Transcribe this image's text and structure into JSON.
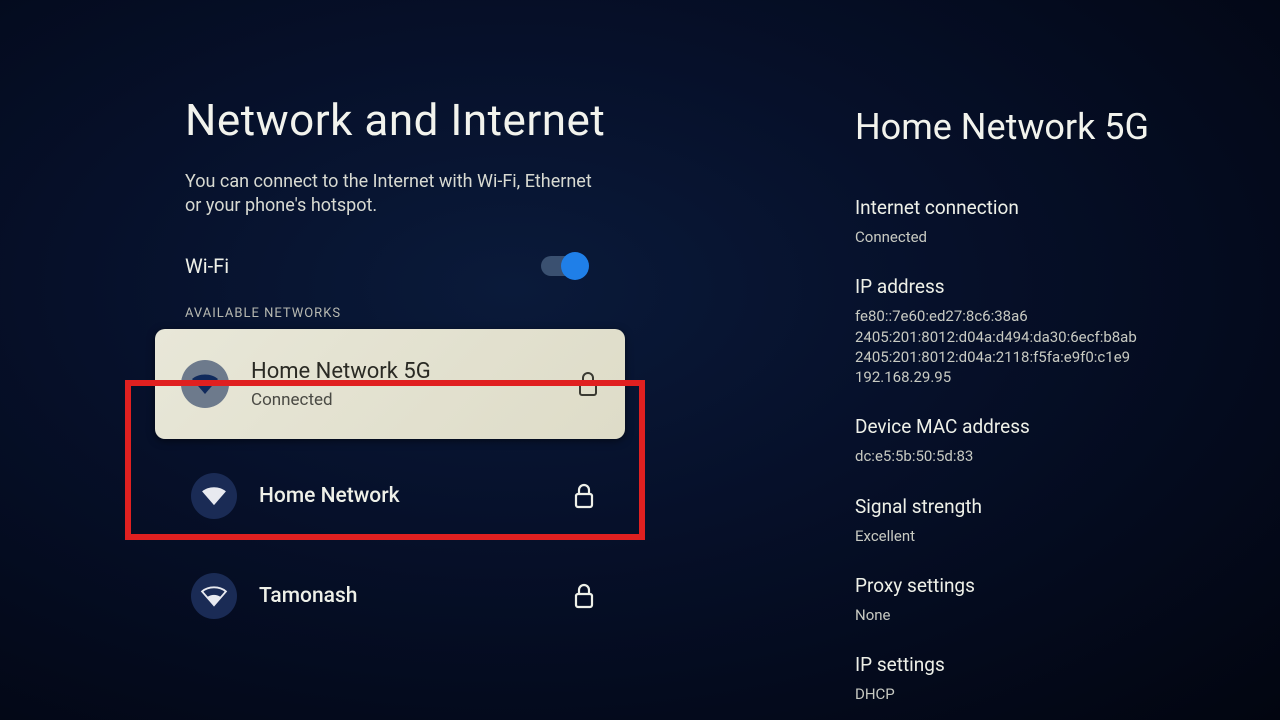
{
  "left": {
    "title": "Network and Internet",
    "subtitle": "You can connect to the Internet with Wi-Fi, Ethernet or your phone's hotspot.",
    "wifi_label": "Wi-Fi",
    "wifi_on": true,
    "available_label": "AVAILABLE NETWORKS",
    "networks": [
      {
        "name": "Home Network 5G",
        "status": "Connected",
        "secured": true,
        "selected": true
      },
      {
        "name": "Home Network",
        "status": "",
        "secured": true,
        "selected": false
      },
      {
        "name": "Tamonash",
        "status": "",
        "secured": true,
        "selected": false
      }
    ]
  },
  "right": {
    "title": "Home Network 5G",
    "items": [
      {
        "label": "Internet connection",
        "value": "Connected"
      },
      {
        "label": "IP address",
        "value": "fe80::7e60:ed27:8c6:38a6\n2405:201:8012:d04a:d494:da30:6ecf:b8ab\n2405:201:8012:d04a:2118:f5fa:e9f0:c1e9\n192.168.29.95"
      },
      {
        "label": "Device MAC address",
        "value": "dc:e5:5b:50:5d:83"
      },
      {
        "label": "Signal strength",
        "value": "Excellent"
      },
      {
        "label": "Proxy settings",
        "value": "None"
      },
      {
        "label": "IP settings",
        "value": "DHCP"
      }
    ]
  }
}
